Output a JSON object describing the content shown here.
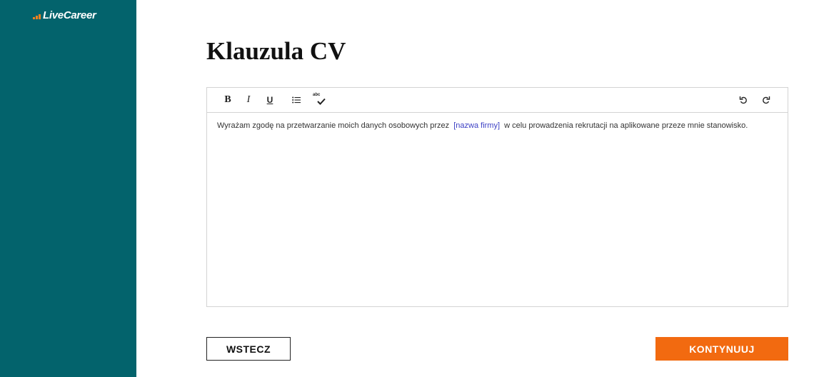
{
  "brand": {
    "name": "LiveCareer",
    "sidebar_color": "#03636c",
    "accent_color": "#f5821f"
  },
  "page": {
    "title": "Klauzula CV"
  },
  "editor": {
    "toolbar": {
      "bold_label": "B",
      "italic_label": "I",
      "underline_label": "U",
      "list_icon": "bulleted-list-icon",
      "spellcheck_label": "abc",
      "spellcheck_icon": "spellcheck-icon",
      "undo_icon": "undo-icon",
      "redo_icon": "redo-icon"
    },
    "content": {
      "text_before": "Wyrażam zgodę na przetwarzanie moich danych osobowych przez",
      "placeholder": "[nazwa firmy]",
      "text_after": "w celu prowadzenia rekrutacji na aplikowane przeze mnie stanowisko.",
      "placeholder_color": "#3b3fc4"
    }
  },
  "actions": {
    "back_label": "WSTECZ",
    "continue_label": "KONTYNUUJ",
    "continue_color": "#f26a10"
  }
}
